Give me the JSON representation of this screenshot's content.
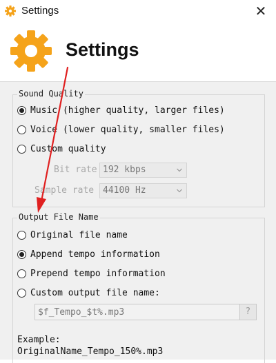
{
  "window": {
    "title": "Settings",
    "close_glyph": "✕"
  },
  "header": {
    "heading": "Settings",
    "icon": "gear-icon",
    "accent": "#f5a31a"
  },
  "sound_quality": {
    "legend": "Sound Quality",
    "options": [
      {
        "label": "Music (higher quality, larger files)",
        "selected": true
      },
      {
        "label": "Voice (lower quality, smaller files)",
        "selected": false
      },
      {
        "label": "Custom quality",
        "selected": false
      }
    ],
    "bit_rate_label": "Bit rate",
    "bit_rate_value": "192 kbps",
    "sample_rate_label": "Sample rate",
    "sample_rate_value": "44100 Hz"
  },
  "output_file_name": {
    "legend": "Output File Name",
    "options": [
      {
        "label": "Original file name",
        "selected": false
      },
      {
        "label": "Append tempo information",
        "selected": true
      },
      {
        "label": "Prepend tempo information",
        "selected": false
      },
      {
        "label": "Custom output file name:",
        "selected": false
      }
    ],
    "custom_value": "$f_Tempo_$t%.mp3",
    "help_label": "?",
    "example_label": "Example:",
    "example_value": "OriginalName_Tempo_150%.mp3"
  },
  "annotation": {
    "arrow_color": "#e02020"
  }
}
